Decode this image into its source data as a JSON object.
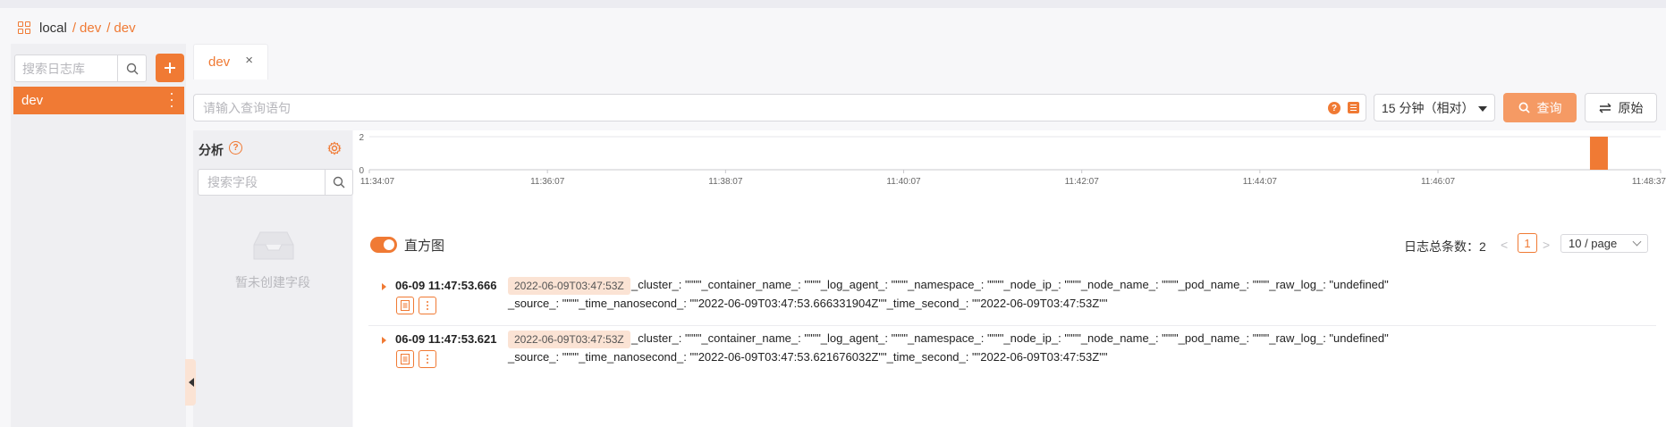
{
  "breadcrumb": {
    "root": "local",
    "seg1": "dev",
    "seg2": "dev",
    "sep": "/"
  },
  "sidebar": {
    "search_placeholder": "搜索日志库",
    "add_icon": "plus-icon",
    "items": [
      {
        "label": "dev"
      }
    ]
  },
  "tabs": [
    {
      "label": "dev",
      "close": "×"
    }
  ],
  "query": {
    "placeholder": "请输入查询语句",
    "help_label": "?",
    "time_range": "15 分钟（相对）",
    "query_button": "查询",
    "raw_button": "原始"
  },
  "fields_panel": {
    "title": "分析",
    "help_label": "?",
    "search_placeholder": "搜索字段",
    "empty_text": "暂未创建字段"
  },
  "histogram": {
    "toggle_label": "直方图",
    "total_label": "日志总条数：",
    "total_value": "2",
    "prev": "<",
    "next": ">",
    "current_page": "1",
    "page_size": "10 / page"
  },
  "chart_data": {
    "type": "bar",
    "x": [
      "11:34:07",
      "11:36:07",
      "11:38:07",
      "11:40:07",
      "11:42:07",
      "11:44:07",
      "11:46:07",
      "11:48:37"
    ],
    "yticks": [
      "2",
      "0"
    ],
    "ylim": [
      0,
      2
    ],
    "bars": [
      {
        "time": "11:47:53",
        "value": 2
      }
    ],
    "color": "#f07a34"
  },
  "logs": [
    {
      "time": "06-09 11:47:53.666",
      "tag": "2022-06-09T03:47:53Z",
      "line1": "_cluster_: \"\"\"\"_container_name_: \"\"\"\"_log_agent_: \"\"\"\"_namespace_: \"\"\"\"_node_ip_: \"\"\"\"_node_name_: \"\"\"\"_pod_name_: \"\"\"\"_raw_log_: \"undefined\"",
      "line2": "_source_: \"\"\"\"_time_nanosecond_: \"\"2022-06-09T03:47:53.666331904Z\"\"_time_second_: \"\"2022-06-09T03:47:53Z\"\""
    },
    {
      "time": "06-09 11:47:53.621",
      "tag": "2022-06-09T03:47:53Z",
      "line1": "_cluster_: \"\"\"\"_container_name_: \"\"\"\"_log_agent_: \"\"\"\"_namespace_: \"\"\"\"_node_ip_: \"\"\"\"_node_name_: \"\"\"\"_pod_name_: \"\"\"\"_raw_log_: \"undefined\"",
      "line2": "_source_: \"\"\"\"_time_nanosecond_: \"\"2022-06-09T03:47:53.621676032Z\"\"_time_second_: \"\"2022-06-09T03:47:53Z\"\""
    }
  ],
  "colors": {
    "accent": "#f07a34",
    "accent_light": "#fbe3d4",
    "query_button": "#f59a64"
  }
}
